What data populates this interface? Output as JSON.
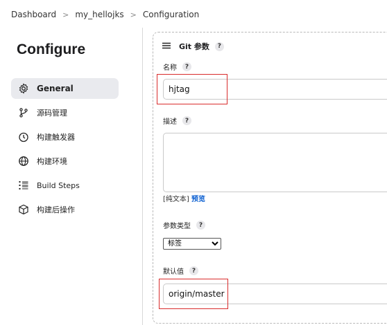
{
  "breadcrumb": {
    "items": [
      "Dashboard",
      "my_hellojks",
      "Configuration"
    ]
  },
  "page": {
    "title": "Configure"
  },
  "sidebar": {
    "items": [
      {
        "label": "General",
        "icon": "gear-icon",
        "active": true
      },
      {
        "label": "源码管理",
        "icon": "branch-icon"
      },
      {
        "label": "构建触发器",
        "icon": "clock-icon"
      },
      {
        "label": "构建环境",
        "icon": "globe-icon"
      },
      {
        "label": "Build Steps",
        "icon": "list-icon"
      },
      {
        "label": "构建后操作",
        "icon": "cube-icon"
      }
    ]
  },
  "param": {
    "header": "Git 参数",
    "name_label": "名称",
    "name_value": "hjtag",
    "desc_label": "描述",
    "desc_value": "",
    "plain_text": "[纯文本]",
    "preview": "预览",
    "type_label": "参数类型",
    "type_value": "标签",
    "default_label": "默认值",
    "default_value": "origin/master",
    "help": "?"
  },
  "colors": {
    "highlight": "#d92b2b",
    "link": "#0b5fd1",
    "active_bg": "#e9eaee"
  }
}
